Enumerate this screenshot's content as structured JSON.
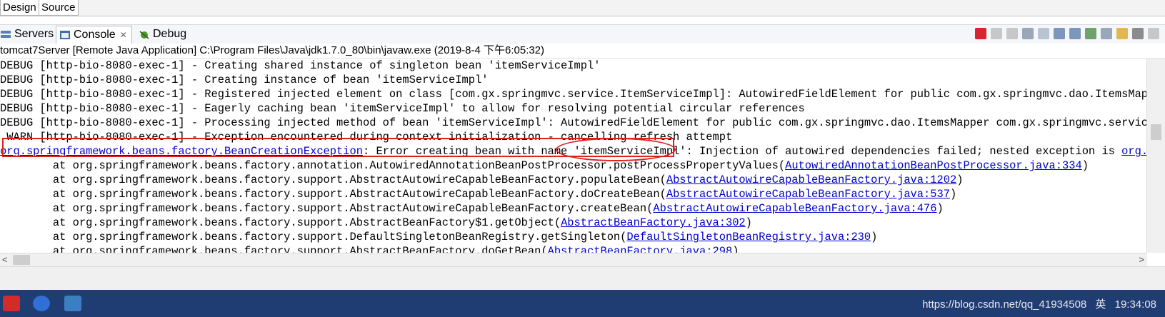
{
  "editor_tabs": [
    "Design",
    "Source"
  ],
  "view_tabs": [
    {
      "label": "Servers",
      "icon": "servers-icon"
    },
    {
      "label": "Console",
      "icon": "console-icon"
    },
    {
      "label": "Debug",
      "icon": "debug-icon"
    }
  ],
  "launch_info": "tomcat7Server [Remote Java Application] C:\\Program Files\\Java\\jdk1.7.0_80\\bin\\javaw.exe (2019-8-4 下午6:05:32)",
  "console_lines": [
    {
      "text": "DEBUG [http-bio-8080-exec-1] - Creating shared instance of singleton bean 'itemServiceImpl'"
    },
    {
      "text": "DEBUG [http-bio-8080-exec-1] - Creating instance of bean 'itemServiceImpl'"
    },
    {
      "text": "DEBUG [http-bio-8080-exec-1] - Registered injected element on class [com.gx.springmvc.service.ItemServiceImpl]: AutowiredFieldElement for public com.gx.springmvc.dao.ItemsMapper c"
    },
    {
      "text": "DEBUG [http-bio-8080-exec-1] - Eagerly caching bean 'itemServiceImpl' to allow for resolving potential circular references"
    },
    {
      "text": "DEBUG [http-bio-8080-exec-1] - Processing injected method of bean 'itemServiceImpl': AutowiredFieldElement for public com.gx.springmvc.dao.ItemsMapper com.gx.springmvc.service.Ite"
    },
    {
      "text": " WARN [http-bio-8080-exec-1] - Exception encountered during context initialization - cancelling refresh attempt"
    },
    {
      "link": "org.springframework.beans.factory.BeanCreationException",
      "text": ": Error creating bean with name 'itemServiceImpl': Injection of autowired dependencies failed; nested exception is ",
      "link2": "org.sprin"
    },
    {
      "text": "        at org.springframework.beans.factory.annotation.AutowiredAnnotationBeanPostProcessor.postProcessPropertyValues(",
      "link": "AutowiredAnnotationBeanPostProcessor.java:334",
      "tail": ")"
    },
    {
      "text": "        at org.springframework.beans.factory.support.AbstractAutowireCapableBeanFactory.populateBean(",
      "link": "AbstractAutowireCapableBeanFactory.java:1202",
      "tail": ")"
    },
    {
      "text": "        at org.springframework.beans.factory.support.AbstractAutowireCapableBeanFactory.doCreateBean(",
      "link": "AbstractAutowireCapableBeanFactory.java:537",
      "tail": ")"
    },
    {
      "text": "        at org.springframework.beans.factory.support.AbstractAutowireCapableBeanFactory.createBean(",
      "link": "AbstractAutowireCapableBeanFactory.java:476",
      "tail": ")"
    },
    {
      "text": "        at org.springframework.beans.factory.support.AbstractBeanFactory$1.getObject(",
      "link": "AbstractBeanFactory.java:302",
      "tail": ")"
    },
    {
      "text": "        at org.springframework.beans.factory.support.DefaultSingletonBeanRegistry.getSingleton(",
      "link": "DefaultSingletonBeanRegistry.java:230",
      "tail": ")"
    },
    {
      "text": "        at org.springframework.beans.factory.support.AbstractBeanFactory.doGetBean(",
      "link": "AbstractBeanFactory.java:298",
      "tail": ")"
    }
  ],
  "taskbar": {
    "tray_text": "https://blog.csdn.net/qq_41934508",
    "ime": "英",
    "clock": "19:34:08"
  },
  "colors": {
    "link": "#0000cc",
    "annotation": "#e02020",
    "taskbar": "#1f3c73"
  }
}
